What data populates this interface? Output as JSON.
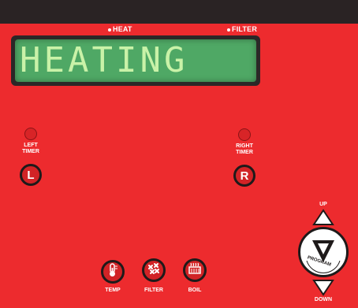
{
  "indicators": {
    "heat": "HEAT",
    "filter": "FILTER"
  },
  "display": {
    "text": "HEATING"
  },
  "left_timer": {
    "label_line1": "LEFT",
    "label_line2": "TIMER",
    "button": "L"
  },
  "right_timer": {
    "label_line1": "RIGHT",
    "label_line2": "TIMER",
    "button": "R"
  },
  "functions": {
    "temp": "TEMP",
    "filter": "FILTER",
    "boil": "BOIL"
  },
  "program": {
    "up": "UP",
    "down": "DOWN",
    "label": "PROGRAM",
    "logo": "V"
  },
  "colors": {
    "panel": "#ed2b2e",
    "top_bar": "#2a2324",
    "lcd_background": "#4fa865",
    "lcd_text": "#c9f2a8"
  }
}
